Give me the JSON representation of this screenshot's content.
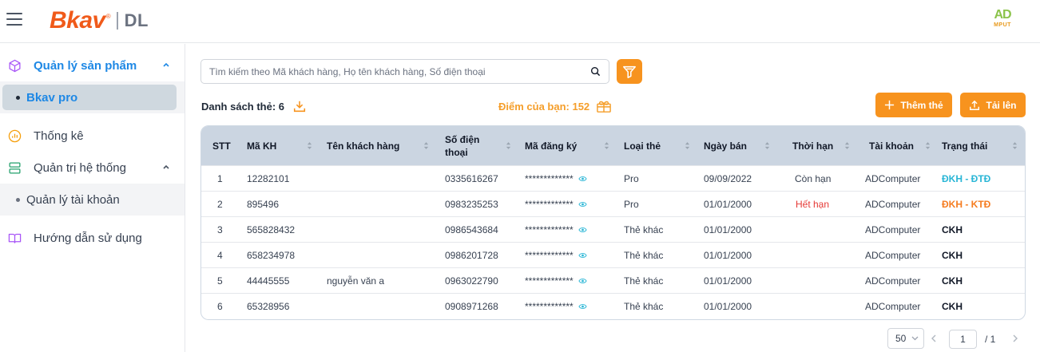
{
  "header": {
    "logo_main": "Bkav",
    "logo_reg": "®",
    "logo_sub": "DL",
    "brand_right_top": "AD",
    "brand_right_bottom": "MPUT"
  },
  "sidebar": {
    "items": [
      {
        "label": "Quản lý sản phẩm",
        "icon": "cube-icon",
        "active": true,
        "expanded": true
      },
      {
        "label": "Thống kê",
        "icon": "chart-icon"
      },
      {
        "label": "Quản trị hệ thống",
        "icon": "server-icon",
        "expanded": true
      },
      {
        "label": "Hướng dẫn sử dụng",
        "icon": "book-icon"
      }
    ],
    "sub_products": [
      {
        "label": "Bkav pro",
        "selected": true
      }
    ],
    "sub_system": [
      {
        "label": "Quản lý tài khoản"
      }
    ]
  },
  "toolbar": {
    "search_placeholder": "Tìm kiếm theo Mã khách hàng, Họ tên khách hàng, Số điện thoại",
    "list_label": "Danh sách thẻ: 6",
    "points_label": "Điểm của bạn: 152",
    "add_label": "Thêm thẻ",
    "upload_label": "Tải lên"
  },
  "table": {
    "headers": [
      "STT",
      "Mã KH",
      "Tên khách hàng",
      "Số điện thoại",
      "Mã đăng ký",
      "Loại thẻ",
      "Ngày bán",
      "Thời hạn",
      "Tài khoản",
      "Trạng thái"
    ],
    "phone_header_line1": "Số điện",
    "phone_header_line2": "thoại",
    "rows": [
      {
        "stt": "1",
        "ma_kh": "12282101",
        "ten": "",
        "sdt": "0335616267",
        "ma_dk": "*************",
        "loai": "Pro",
        "ngay": "09/09/2022",
        "han": "Còn hạn",
        "tk": "ADComputer",
        "status": "ĐKH - ĐTĐ"
      },
      {
        "stt": "2",
        "ma_kh": "895496",
        "ten": "",
        "sdt": "0983235253",
        "ma_dk": "*************",
        "loai": "Pro",
        "ngay": "01/01/2000",
        "han": "Hết hạn",
        "tk": "ADComputer",
        "status": "ĐKH - KTĐ"
      },
      {
        "stt": "3",
        "ma_kh": "565828432",
        "ten": "",
        "sdt": "0986543684",
        "ma_dk": "*************",
        "loai": "Thẻ khác",
        "ngay": "01/01/2000",
        "han": "",
        "tk": "ADComputer",
        "status": "CKH"
      },
      {
        "stt": "4",
        "ma_kh": "658234978",
        "ten": "",
        "sdt": "0986201728",
        "ma_dk": "*************",
        "loai": "Thẻ khác",
        "ngay": "01/01/2000",
        "han": "",
        "tk": "ADComputer",
        "status": "CKH"
      },
      {
        "stt": "5",
        "ma_kh": "44445555",
        "ten": "nguyễn văn a",
        "sdt": "0963022790",
        "ma_dk": "*************",
        "loai": "Thẻ khác",
        "ngay": "01/01/2000",
        "han": "",
        "tk": "ADComputer",
        "status": "CKH"
      },
      {
        "stt": "6",
        "ma_kh": "65328956",
        "ten": "",
        "sdt": "0908971268",
        "ma_dk": "*************",
        "loai": "Thẻ khác",
        "ngay": "01/01/2000",
        "han": "",
        "tk": "ADComputer",
        "status": "CKH"
      }
    ]
  },
  "pagination": {
    "page_size": "50",
    "current_page": "1",
    "total_pages": "/ 1"
  },
  "colors": {
    "accent_orange": "#f7931e",
    "active_blue": "#1e88e5",
    "status_cyan": "#29b6d6",
    "status_orange": "#f57c20",
    "expired_red": "#e53935",
    "header_gray": "#cbd5e1"
  }
}
